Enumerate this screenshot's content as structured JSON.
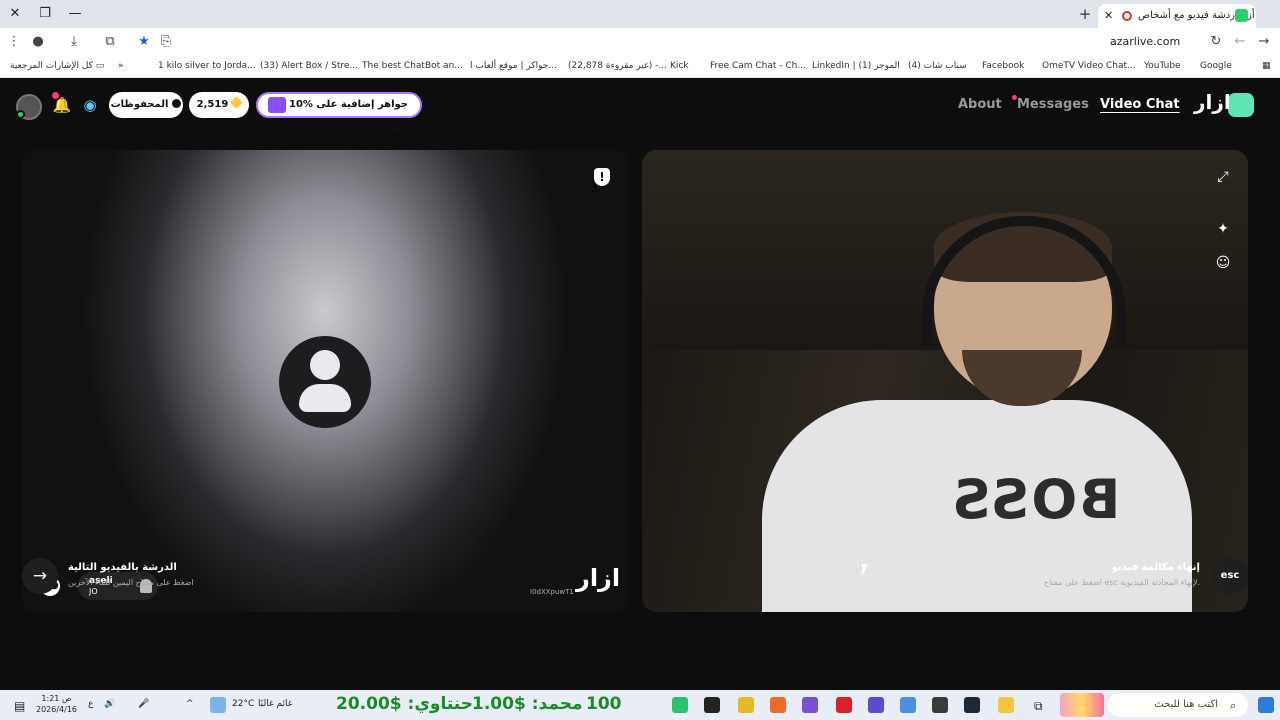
{
  "browser": {
    "tab_title": "أزاردردشة فيديو مع أشخاص",
    "url": "azarlive.com",
    "bookmarks_all": "كل الإشارات المرجعية",
    "bookmarks": [
      "1 kilo silver to Jorda...",
      "(33) Alert Box / Stre...",
      "The best ChatBot an...",
      "جواكر | موقع ألعاب ا...",
      "(22,878 غير مقروءة) -...",
      "Kick",
      "Free Cam Chat - Ch...",
      "LinkedIn | (1) الموجز",
      "(4) سناب شات",
      "Facebook",
      "OmeTV Video Chat...",
      "YouTube",
      "Google"
    ]
  },
  "app": {
    "logo_text": "ازار",
    "nav": {
      "video_chat": "Video Chat",
      "messages": "Messages",
      "about": "About"
    },
    "promo_text": "10% جواهر إضافية على الويب!",
    "gems": "2,519",
    "saved_label": "المحفوظات",
    "notification_count": "1"
  },
  "left_video": {
    "watermark": "ازار",
    "match_id": "I0dXXpuwT1",
    "partner_name": "aseli",
    "partner_country": "JO",
    "chat_count": "1"
  },
  "controls": {
    "next_title": "الدرشة بالفيديو التالية",
    "next_sub": "اضغط على مفتاح اليمين للقاء الآخرين",
    "esc_label": "esc",
    "end_title": "إنهاء مكالمة فيديو",
    "end_sub": "اضغط على مفتاح esc لإنهاء المحادثة الفيديوية."
  },
  "taskbar": {
    "time": "1:21 ص",
    "date": "2026/4/16",
    "lang": "ع",
    "weather_temp": "22°C",
    "weather_desc": "غائم غالبًا",
    "ticker_1": "20.00$ :حنتاوي",
    "ticker_2": "1.00$ :محمد",
    "ticker_3": "100",
    "search_placeholder": "اكتب هنا للبحث"
  },
  "colors": {
    "accent": "#5ee5b3",
    "promo_border": "#a57bff",
    "notify": "#ff3b6b"
  }
}
